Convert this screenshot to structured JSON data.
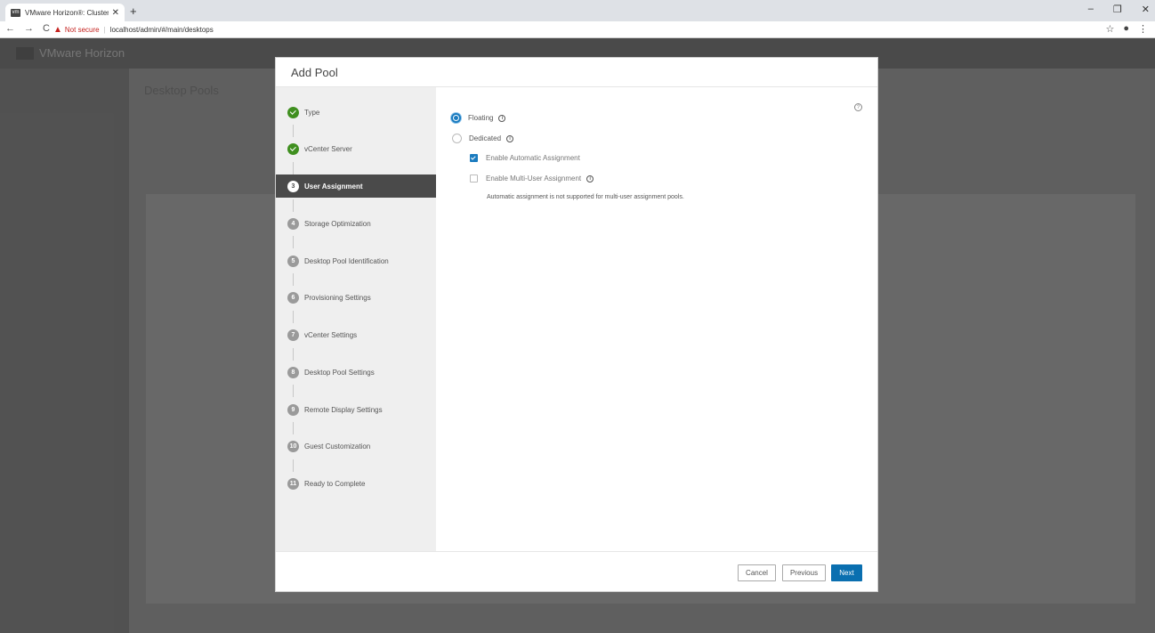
{
  "browser": {
    "tab_title": "VMware Horizon®: Cluster-FS-",
    "url_warning": "Not secure",
    "url": "localhost/admin/#/main/desktops"
  },
  "app": {
    "logo_text": "VMware Horizon",
    "page_title": "Desktop Pools"
  },
  "modal": {
    "title": "Add Pool",
    "steps": [
      {
        "num": "1",
        "label": "Type",
        "state": "done"
      },
      {
        "num": "2",
        "label": "vCenter Server",
        "state": "done"
      },
      {
        "num": "3",
        "label": "User Assignment",
        "state": "active"
      },
      {
        "num": "4",
        "label": "Storage Optimization",
        "state": "pending"
      },
      {
        "num": "5",
        "label": "Desktop Pool Identification",
        "state": "pending"
      },
      {
        "num": "6",
        "label": "Provisioning Settings",
        "state": "pending"
      },
      {
        "num": "7",
        "label": "vCenter Settings",
        "state": "pending"
      },
      {
        "num": "8",
        "label": "Desktop Pool Settings",
        "state": "pending"
      },
      {
        "num": "9",
        "label": "Remote Display Settings",
        "state": "pending"
      },
      {
        "num": "10",
        "label": "Guest Customization",
        "state": "pending"
      },
      {
        "num": "11",
        "label": "Ready to Complete",
        "state": "pending"
      }
    ],
    "options": {
      "floating": "Floating",
      "dedicated": "Dedicated",
      "auto_assign": "Enable Automatic Assignment",
      "multi_user": "Enable Multi-User Assignment",
      "note": "Automatic assignment is not supported for multi-user assignment pools."
    },
    "buttons": {
      "cancel": "Cancel",
      "previous": "Previous",
      "next": "Next"
    }
  },
  "colors": {
    "accent": "#0a6fb0",
    "step_done": "#3f8f1f",
    "step_active_bg": "#4a4a4a"
  }
}
